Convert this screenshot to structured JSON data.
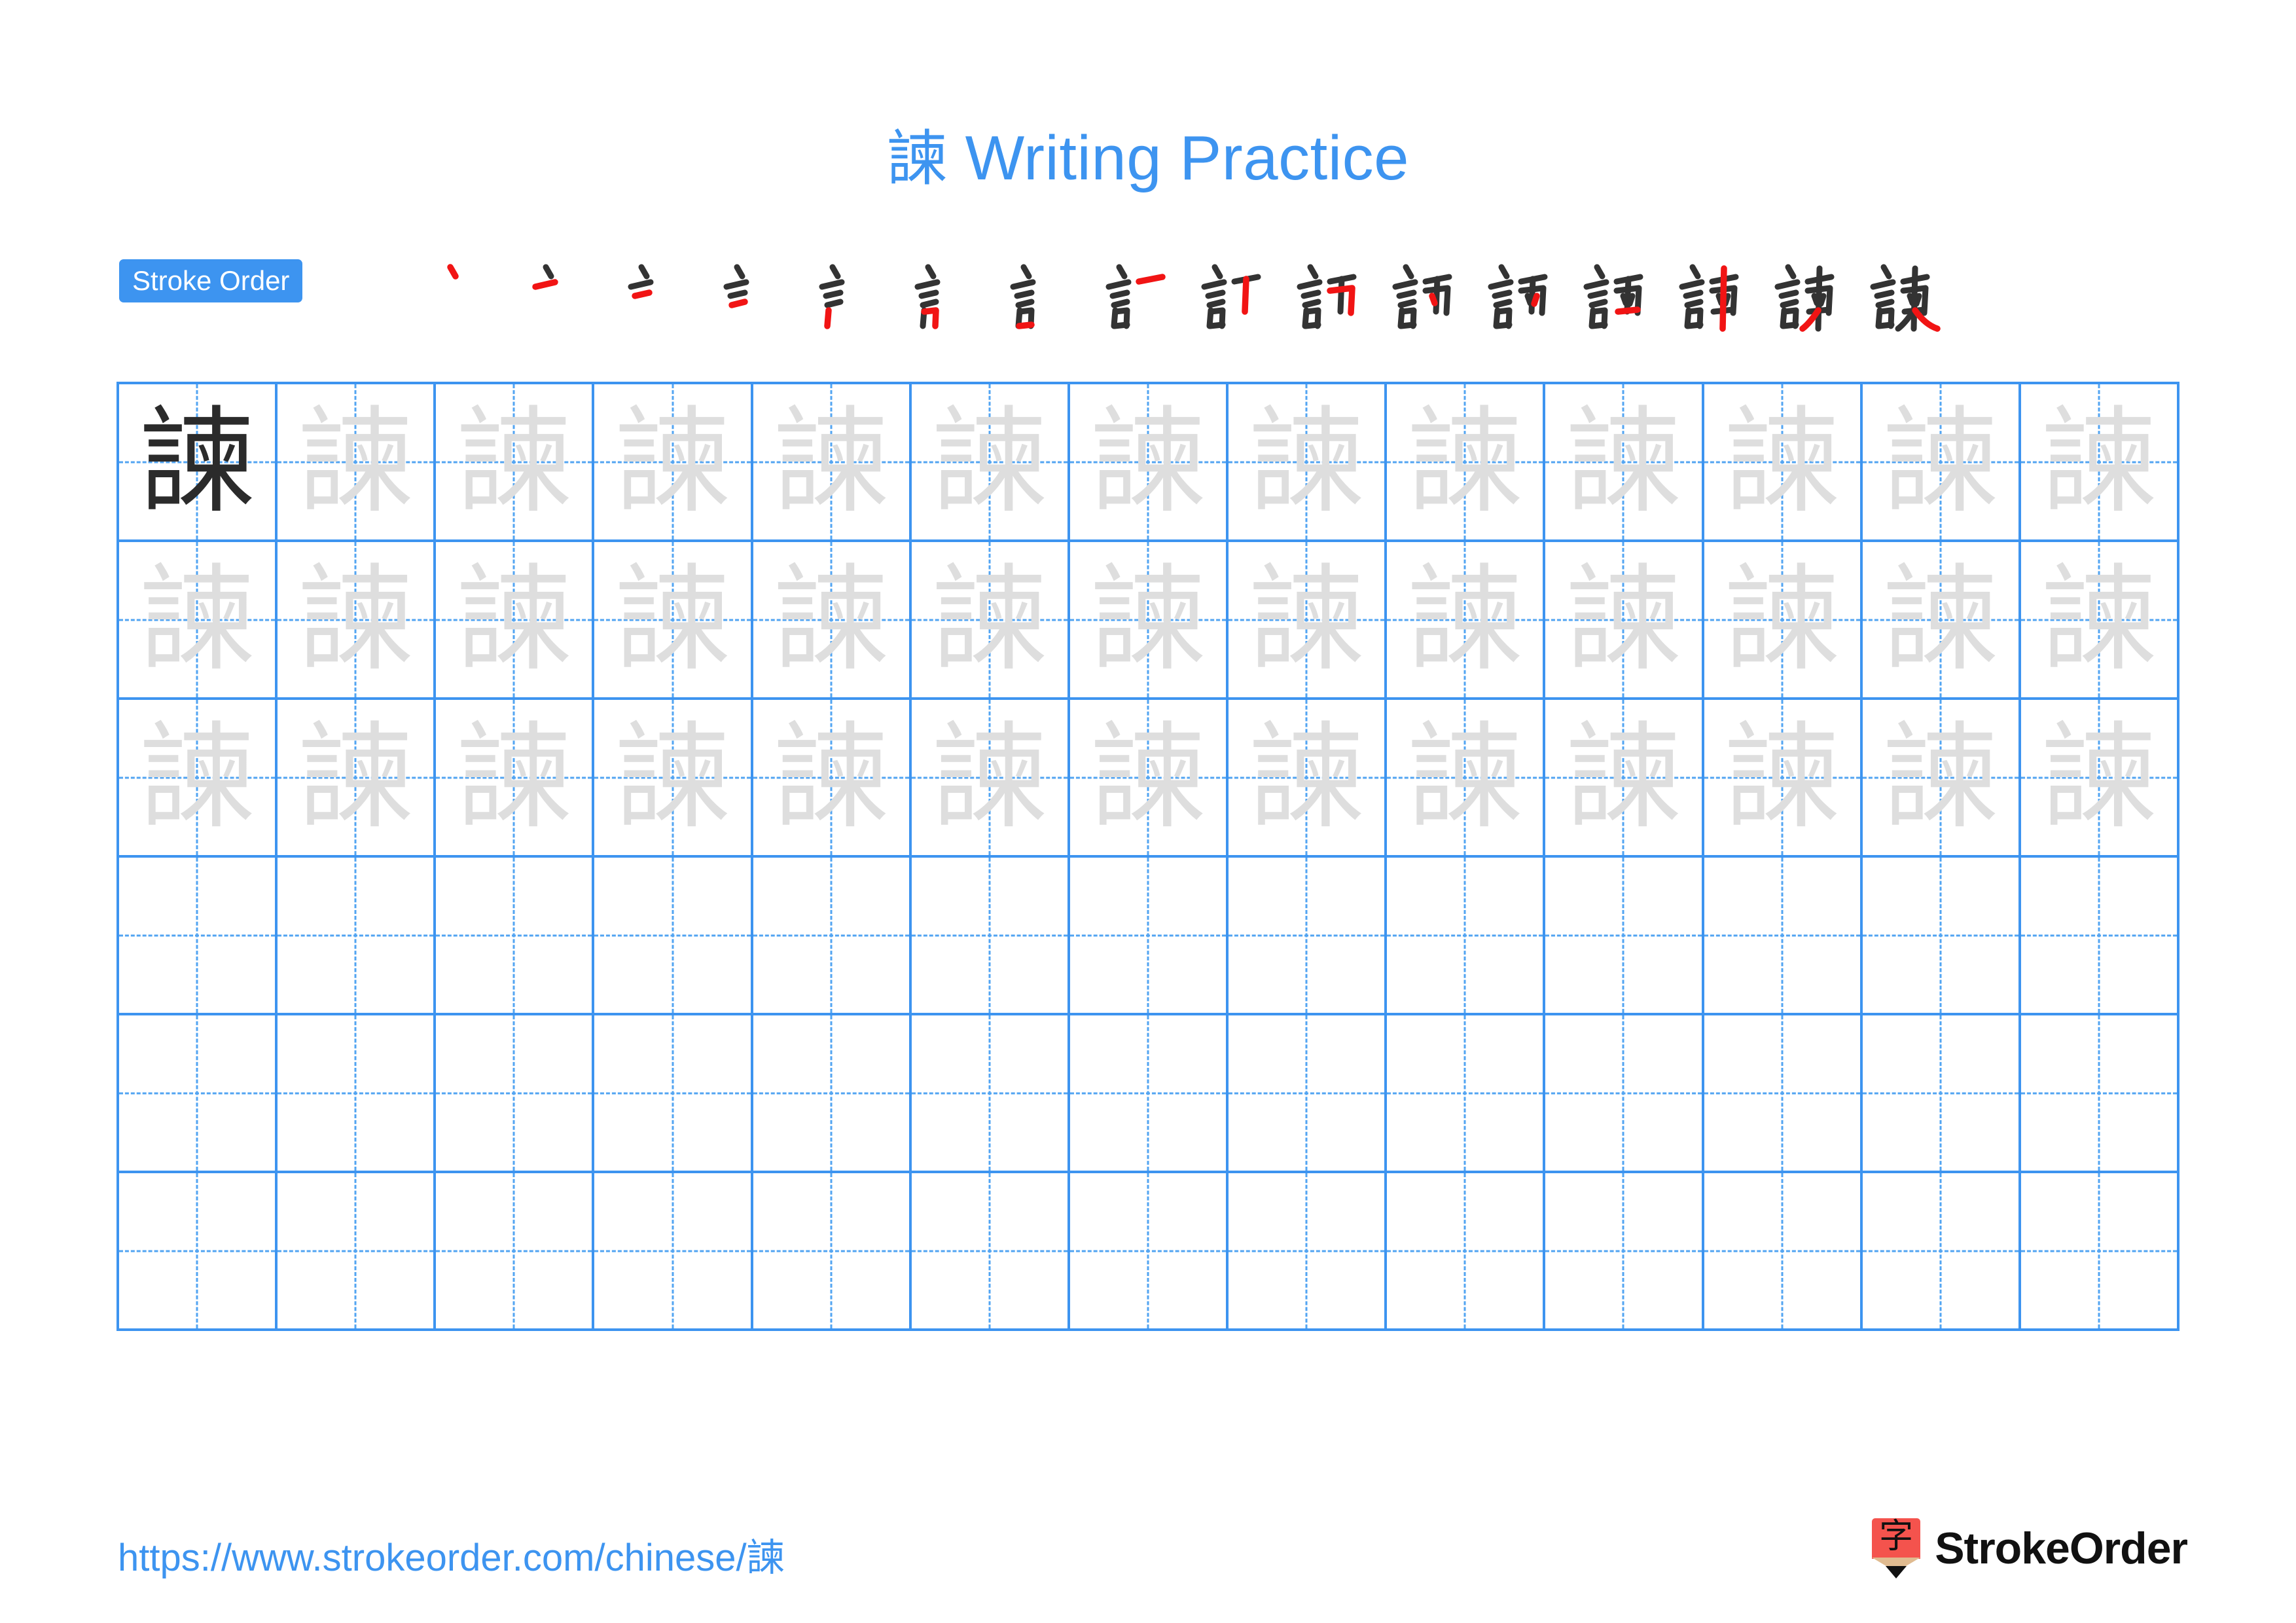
{
  "page": {
    "character": "諫",
    "title_suffix": " Writing Practice",
    "accent_color": "#3d94f0",
    "grid_line_color": "#3d94f0",
    "trace_char_color": "#dedede",
    "model_char_color": "#2b2b2b",
    "new_stroke_color": "#f11414",
    "past_stroke_color": "#333333"
  },
  "stroke_order": {
    "badge_label": "Stroke Order",
    "total_strokes": 16,
    "steps": [
      {
        "index": 1,
        "char": "諫"
      },
      {
        "index": 2,
        "char": "諫"
      },
      {
        "index": 3,
        "char": "諫"
      },
      {
        "index": 4,
        "char": "諫"
      },
      {
        "index": 5,
        "char": "諫"
      },
      {
        "index": 6,
        "char": "諫"
      },
      {
        "index": 7,
        "char": "諫"
      },
      {
        "index": 8,
        "char": "諫"
      },
      {
        "index": 9,
        "char": "諫"
      },
      {
        "index": 10,
        "char": "諫"
      },
      {
        "index": 11,
        "char": "諫"
      },
      {
        "index": 12,
        "char": "諫"
      },
      {
        "index": 13,
        "char": "諫"
      },
      {
        "index": 14,
        "char": "諫"
      },
      {
        "index": 15,
        "char": "諫"
      },
      {
        "index": 16,
        "char": "諫"
      }
    ]
  },
  "grid": {
    "columns": 13,
    "rows": 6,
    "model_cell": {
      "row": 1,
      "column": 1,
      "char": "諫"
    },
    "traced_rows": [
      1,
      2,
      3
    ],
    "blank_rows": [
      4,
      5,
      6
    ],
    "trace_char": "諫"
  },
  "footer": {
    "url": "https://www.strokeorder.com/chinese/諫",
    "brand_name": "StrokeOrder",
    "brand_glyph": "字"
  }
}
